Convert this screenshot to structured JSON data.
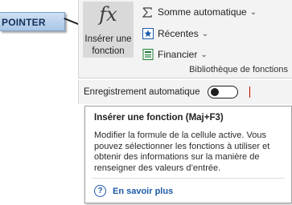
{
  "callout": {
    "label": "POINTER"
  },
  "ribbon": {
    "insert_function": {
      "icon": "fx-icon",
      "glyph": "fx",
      "label_line1": "Insérer une",
      "label_line2": "fonction"
    },
    "items": [
      {
        "icon": "sigma-icon",
        "glyph": "∑",
        "label": "Somme automatique",
        "chevron": "⌄"
      },
      {
        "icon": "star-icon",
        "glyph": "★",
        "label": "Récentes",
        "chevron": "⌄"
      },
      {
        "icon": "book-icon",
        "glyph": "▤",
        "label": "Financier",
        "chevron": "⌄"
      }
    ],
    "group_label": "Bibliothèque de fonctions"
  },
  "autosave": {
    "label": "Enregistrement automatique",
    "state": "off"
  },
  "tooltip": {
    "title": "Insérer une fonction (Maj+F3)",
    "body": "Modifier la formule de la cellule active. Vous pouvez sélectionner les fonctions à utiliser et obtenir des informations sur la manière de renseigner des valeurs d’entrée.",
    "help_icon": "?",
    "link": "En savoir plus"
  },
  "colors": {
    "link": "#1e5aa8",
    "callout_bg": "#cfe0f3",
    "ribbon_bg": "#f3f3f3"
  }
}
